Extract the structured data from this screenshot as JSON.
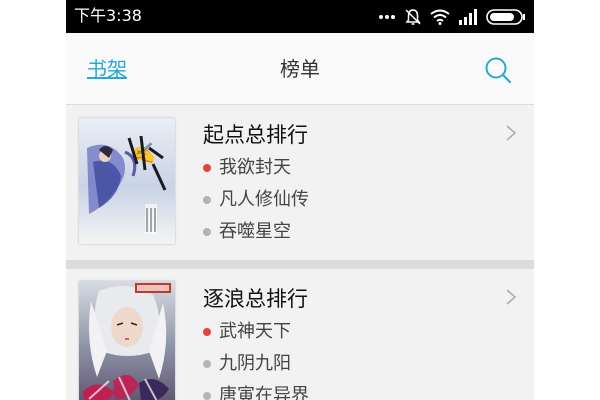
{
  "status_bar": {
    "time": "下午3:38",
    "icons": [
      "more-dots-icon",
      "mute-bell-icon",
      "wifi-icon",
      "signal-icon",
      "battery-icon"
    ]
  },
  "nav": {
    "back_label": "书架",
    "title": "榜单",
    "search_icon": "search-icon"
  },
  "colors": {
    "accent": "#28a8d8",
    "top_dot": "#e0463c",
    "normal_dot": "#b4b4b4",
    "divider": "#dcdcdc",
    "background": "#f2f2f2"
  },
  "rankings": [
    {
      "title": "起点总排行",
      "cover_icon": "book-cover-image",
      "books": [
        {
          "name": "我欲封天",
          "highlight": true
        },
        {
          "name": "凡人修仙传",
          "highlight": false
        },
        {
          "name": "吞噬星空",
          "highlight": false
        }
      ]
    },
    {
      "title": "逐浪总排行",
      "cover_icon": "book-cover-image",
      "books": [
        {
          "name": "武神天下",
          "highlight": true
        },
        {
          "name": "九阴九阳",
          "highlight": false
        },
        {
          "name": "唐寅在异界",
          "highlight": false
        }
      ]
    }
  ]
}
